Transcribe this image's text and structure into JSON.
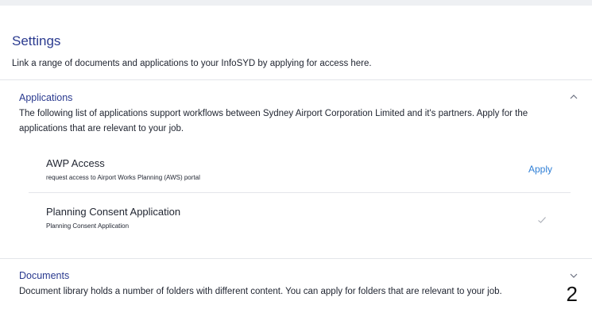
{
  "settings": {
    "title": "Settings",
    "description": "Link a range of documents and applications to your InfoSYD by applying for access here."
  },
  "applications": {
    "title": "Applications",
    "description": "The following list of applications support workflows between Sydney Airport Corporation Limited and it's partners. Apply for the applications that are relevant to your job.",
    "expanded": true,
    "chevron_icon": "chevron-up-icon",
    "items": [
      {
        "name": "AWP Access",
        "subtitle": "request access to Airport Works Planning (AWS) portal",
        "action_label": "Apply",
        "status": "available"
      },
      {
        "name": "Planning Consent Application",
        "subtitle": "Planning Consent Application",
        "status": "granted",
        "status_icon": "check-icon"
      }
    ]
  },
  "documents": {
    "title": "Documents",
    "description": "Document library holds a number of folders with different content. You can apply for folders that are relevant to your job.",
    "expanded": false,
    "chevron_icon": "chevron-down-icon"
  },
  "page_number": "2",
  "colors": {
    "heading": "#2a3a8f",
    "link": "#2f7fd6",
    "text": "#1f2430",
    "divider": "#e3e5ea",
    "topbar": "#eef0f3"
  }
}
